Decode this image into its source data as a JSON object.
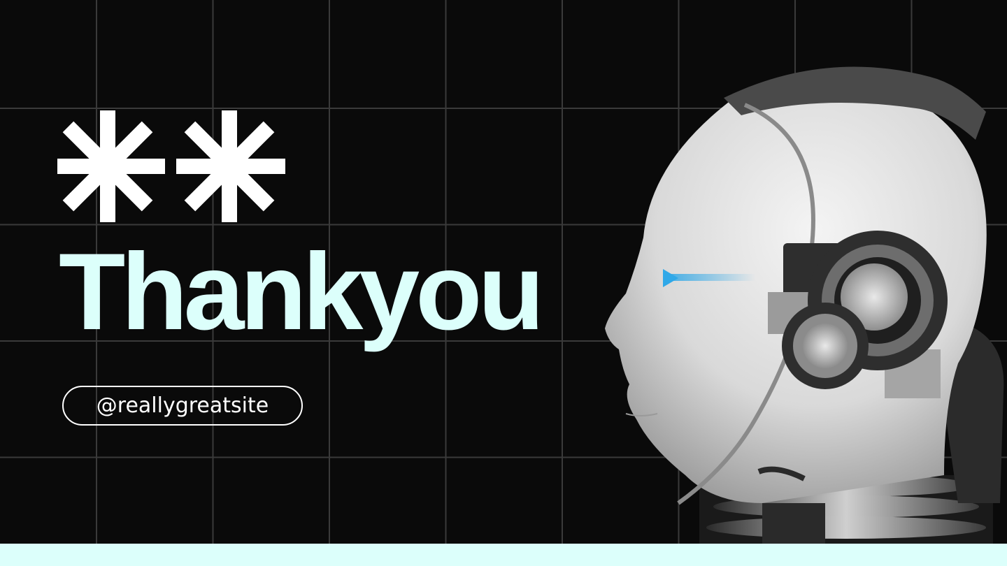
{
  "slide": {
    "title": "Thankyou",
    "handle": "@reallygreatsite"
  },
  "icons": {
    "decoration": "asterisk-icon",
    "image": "robot-head-profile"
  },
  "colors": {
    "background": "#0a0a0a",
    "grid_line": "#3a3a3a",
    "accent": "#dcfffb",
    "text_light": "#ffffff",
    "eye_glow": "#2fa8e8"
  }
}
